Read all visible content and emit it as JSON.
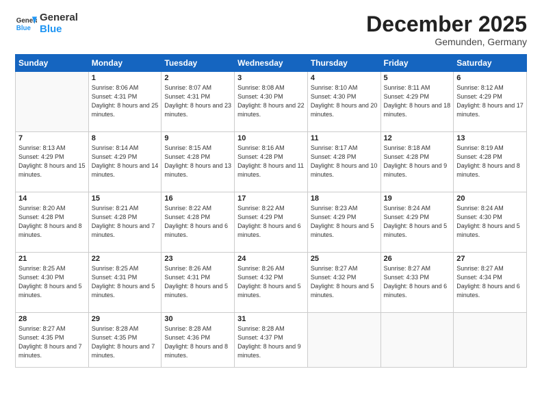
{
  "header": {
    "logo": {
      "general": "General",
      "blue": "Blue"
    },
    "month": "December 2025",
    "location": "Gemunden, Germany"
  },
  "days_of_week": [
    "Sunday",
    "Monday",
    "Tuesday",
    "Wednesday",
    "Thursday",
    "Friday",
    "Saturday"
  ],
  "weeks": [
    [
      {
        "day": null
      },
      {
        "day": "1",
        "sunrise": "8:06 AM",
        "sunset": "4:31 PM",
        "daylight": "8 hours and 25 minutes."
      },
      {
        "day": "2",
        "sunrise": "8:07 AM",
        "sunset": "4:31 PM",
        "daylight": "8 hours and 23 minutes."
      },
      {
        "day": "3",
        "sunrise": "8:08 AM",
        "sunset": "4:30 PM",
        "daylight": "8 hours and 22 minutes."
      },
      {
        "day": "4",
        "sunrise": "8:10 AM",
        "sunset": "4:30 PM",
        "daylight": "8 hours and 20 minutes."
      },
      {
        "day": "5",
        "sunrise": "8:11 AM",
        "sunset": "4:29 PM",
        "daylight": "8 hours and 18 minutes."
      },
      {
        "day": "6",
        "sunrise": "8:12 AM",
        "sunset": "4:29 PM",
        "daylight": "8 hours and 17 minutes."
      }
    ],
    [
      {
        "day": "7",
        "sunrise": "8:13 AM",
        "sunset": "4:29 PM",
        "daylight": "8 hours and 15 minutes."
      },
      {
        "day": "8",
        "sunrise": "8:14 AM",
        "sunset": "4:29 PM",
        "daylight": "8 hours and 14 minutes."
      },
      {
        "day": "9",
        "sunrise": "8:15 AM",
        "sunset": "4:28 PM",
        "daylight": "8 hours and 13 minutes."
      },
      {
        "day": "10",
        "sunrise": "8:16 AM",
        "sunset": "4:28 PM",
        "daylight": "8 hours and 11 minutes."
      },
      {
        "day": "11",
        "sunrise": "8:17 AM",
        "sunset": "4:28 PM",
        "daylight": "8 hours and 10 minutes."
      },
      {
        "day": "12",
        "sunrise": "8:18 AM",
        "sunset": "4:28 PM",
        "daylight": "8 hours and 9 minutes."
      },
      {
        "day": "13",
        "sunrise": "8:19 AM",
        "sunset": "4:28 PM",
        "daylight": "8 hours and 8 minutes."
      }
    ],
    [
      {
        "day": "14",
        "sunrise": "8:20 AM",
        "sunset": "4:28 PM",
        "daylight": "8 hours and 8 minutes."
      },
      {
        "day": "15",
        "sunrise": "8:21 AM",
        "sunset": "4:28 PM",
        "daylight": "8 hours and 7 minutes."
      },
      {
        "day": "16",
        "sunrise": "8:22 AM",
        "sunset": "4:28 PM",
        "daylight": "8 hours and 6 minutes."
      },
      {
        "day": "17",
        "sunrise": "8:22 AM",
        "sunset": "4:29 PM",
        "daylight": "8 hours and 6 minutes."
      },
      {
        "day": "18",
        "sunrise": "8:23 AM",
        "sunset": "4:29 PM",
        "daylight": "8 hours and 5 minutes."
      },
      {
        "day": "19",
        "sunrise": "8:24 AM",
        "sunset": "4:29 PM",
        "daylight": "8 hours and 5 minutes."
      },
      {
        "day": "20",
        "sunrise": "8:24 AM",
        "sunset": "4:30 PM",
        "daylight": "8 hours and 5 minutes."
      }
    ],
    [
      {
        "day": "21",
        "sunrise": "8:25 AM",
        "sunset": "4:30 PM",
        "daylight": "8 hours and 5 minutes."
      },
      {
        "day": "22",
        "sunrise": "8:25 AM",
        "sunset": "4:31 PM",
        "daylight": "8 hours and 5 minutes."
      },
      {
        "day": "23",
        "sunrise": "8:26 AM",
        "sunset": "4:31 PM",
        "daylight": "8 hours and 5 minutes."
      },
      {
        "day": "24",
        "sunrise": "8:26 AM",
        "sunset": "4:32 PM",
        "daylight": "8 hours and 5 minutes."
      },
      {
        "day": "25",
        "sunrise": "8:27 AM",
        "sunset": "4:32 PM",
        "daylight": "8 hours and 5 minutes."
      },
      {
        "day": "26",
        "sunrise": "8:27 AM",
        "sunset": "4:33 PM",
        "daylight": "8 hours and 6 minutes."
      },
      {
        "day": "27",
        "sunrise": "8:27 AM",
        "sunset": "4:34 PM",
        "daylight": "8 hours and 6 minutes."
      }
    ],
    [
      {
        "day": "28",
        "sunrise": "8:27 AM",
        "sunset": "4:35 PM",
        "daylight": "8 hours and 7 minutes."
      },
      {
        "day": "29",
        "sunrise": "8:28 AM",
        "sunset": "4:35 PM",
        "daylight": "8 hours and 7 minutes."
      },
      {
        "day": "30",
        "sunrise": "8:28 AM",
        "sunset": "4:36 PM",
        "daylight": "8 hours and 8 minutes."
      },
      {
        "day": "31",
        "sunrise": "8:28 AM",
        "sunset": "4:37 PM",
        "daylight": "8 hours and 9 minutes."
      },
      {
        "day": null
      },
      {
        "day": null
      },
      {
        "day": null
      }
    ]
  ],
  "cell_labels": {
    "sunrise": "Sunrise:",
    "sunset": "Sunset:",
    "daylight": "Daylight:"
  }
}
